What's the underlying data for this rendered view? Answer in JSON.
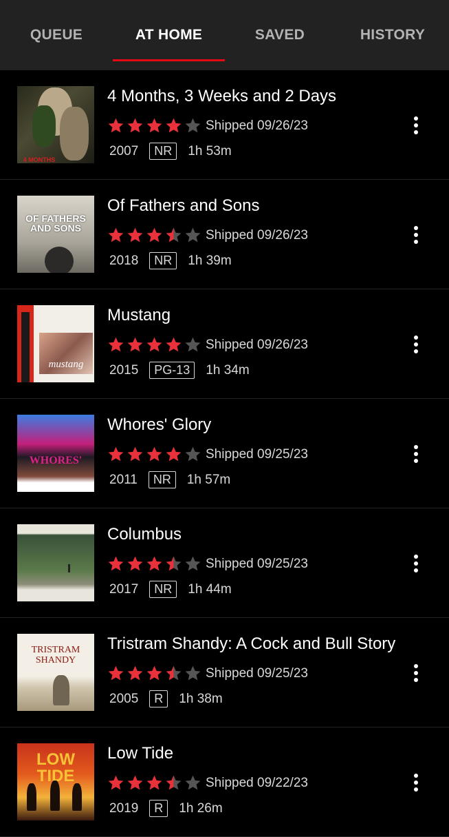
{
  "tabs": [
    {
      "label": "QUEUE",
      "active": false
    },
    {
      "label": "AT HOME",
      "active": true
    },
    {
      "label": "SAVED",
      "active": false
    },
    {
      "label": "HISTORY",
      "active": false
    }
  ],
  "colors": {
    "accent": "#e50914",
    "star_filled": "#e8313a",
    "star_empty": "#555555"
  },
  "movies": [
    {
      "title": "4 Months, 3 Weeks and 2 Days",
      "rating": 4,
      "shipped": "Shipped 09/26/23",
      "year": "2007",
      "mpaa": "NR",
      "runtime": "1h 53m",
      "poster_text": "4 MONTHS"
    },
    {
      "title": "Of Fathers and Sons",
      "rating": 3.5,
      "shipped": "Shipped 09/26/23",
      "year": "2018",
      "mpaa": "NR",
      "runtime": "1h 39m",
      "poster_text": "OF FATHERS AND SONS"
    },
    {
      "title": "Mustang",
      "rating": 4,
      "shipped": "Shipped 09/26/23",
      "year": "2015",
      "mpaa": "PG-13",
      "runtime": "1h 34m",
      "poster_text": "mustang"
    },
    {
      "title": "Whores' Glory",
      "rating": 4,
      "shipped": "Shipped 09/25/23",
      "year": "2011",
      "mpaa": "NR",
      "runtime": "1h 57m",
      "poster_text": "WHORES' GLORY"
    },
    {
      "title": "Columbus",
      "rating": 3.5,
      "shipped": "Shipped 09/25/23",
      "year": "2017",
      "mpaa": "NR",
      "runtime": "1h 44m",
      "poster_text": ""
    },
    {
      "title": "Tristram Shandy: A Cock and Bull Story",
      "rating": 3.5,
      "shipped": "Shipped 09/25/23",
      "year": "2005",
      "mpaa": "R",
      "runtime": "1h 38m",
      "poster_text": "TRISTRAM SHANDY"
    },
    {
      "title": "Low Tide",
      "rating": 3.5,
      "shipped": "Shipped 09/22/23",
      "year": "2019",
      "mpaa": "R",
      "runtime": "1h 26m",
      "poster_text": "LOW TIDE"
    }
  ]
}
